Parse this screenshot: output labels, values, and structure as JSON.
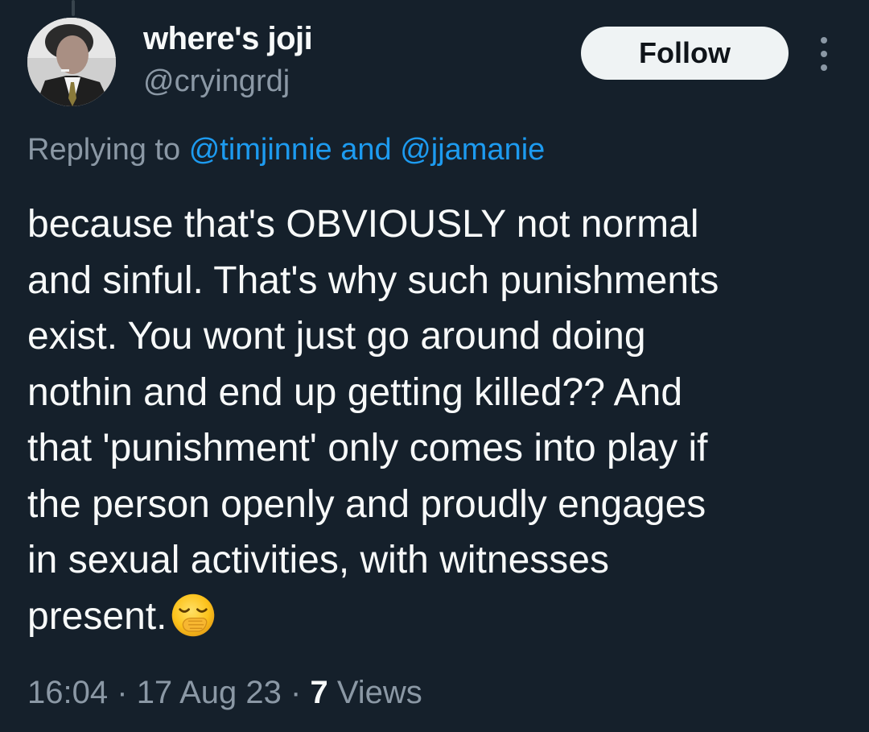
{
  "author": {
    "display_name": "where's joji",
    "handle": "@cryingrdj"
  },
  "follow_button": {
    "label": "Follow"
  },
  "more_icon": "more-dots-icon",
  "reply": {
    "prefix": "Replying to",
    "mention_1": "@timjinnie",
    "conjunction": "and",
    "mention_2": "@jjamanie"
  },
  "tweet": {
    "text": "because that's OBVIOUSLY not normal\nand sinful. That's why such punishments\nexist. You wont just go around doing\nnothin and end up getting killed?? And\nthat 'punishment' only comes into play if\nthe person openly and proudly engages\nin sexual activities, with witnesses\npresent.",
    "emoji": "yawning-face-emoji"
  },
  "meta": {
    "time": "16:04",
    "separator": "·",
    "date": "17 Aug 23",
    "views_count": "7",
    "views_label": "Views"
  },
  "colors": {
    "background": "#15202b",
    "text_primary": "#f7f9f9",
    "text_secondary": "#8b98a5",
    "link": "#1d9bf0",
    "button_bg": "#eff3f4"
  }
}
